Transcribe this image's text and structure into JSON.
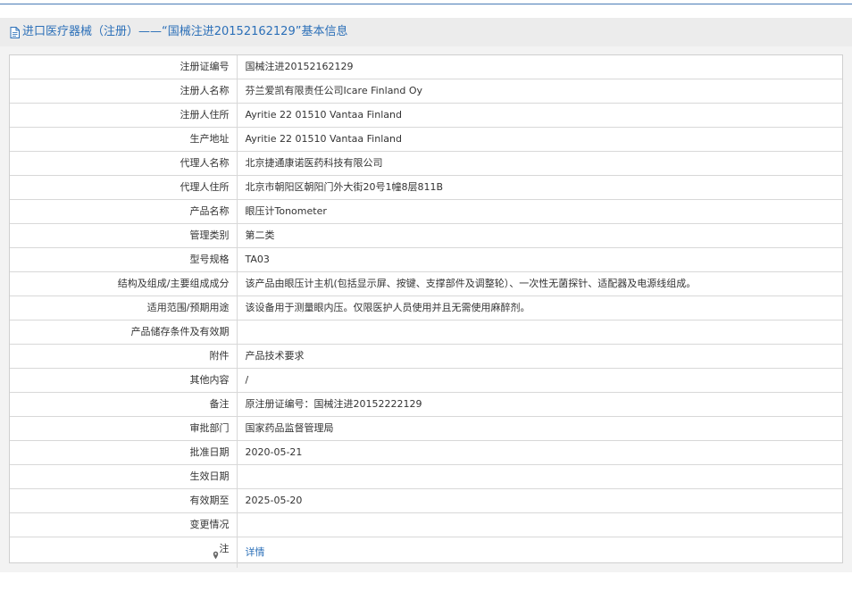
{
  "header": {
    "title": "进口医疗器械（注册）——“国械注进20152162129”基本信息"
  },
  "rows": [
    {
      "label": "注册证编号",
      "value": "国械注进20152162129"
    },
    {
      "label": "注册人名称",
      "value": "芬兰爱凯有限责任公司Icare Finland Oy"
    },
    {
      "label": "注册人住所",
      "value": "Ayritie 22 01510 Vantaa Finland"
    },
    {
      "label": "生产地址",
      "value": "Ayritie 22 01510 Vantaa Finland"
    },
    {
      "label": "代理人名称",
      "value": "北京捷通康诺医药科技有限公司"
    },
    {
      "label": "代理人住所",
      "value": "北京市朝阳区朝阳门外大街20号1幢8层811B"
    },
    {
      "label": "产品名称",
      "value": "眼压计Tonometer"
    },
    {
      "label": "管理类别",
      "value": "第二类"
    },
    {
      "label": "型号规格",
      "value": "TA03"
    },
    {
      "label": "结构及组成/主要组成成分",
      "value": "该产品由眼压计主机(包括显示屏、按键、支撑部件及调整轮）、一次性无菌探针、适配器及电源线组成。"
    },
    {
      "label": "适用范围/预期用途",
      "value": "该设备用于测量眼内压。仅限医护人员使用并且无需使用麻醉剂。"
    },
    {
      "label": "产品储存条件及有效期",
      "value": ""
    },
    {
      "label": "附件",
      "value": "产品技术要求"
    },
    {
      "label": "其他内容",
      "value": "/"
    },
    {
      "label": "备注",
      "value": "原注册证编号：国械注进20152222129"
    },
    {
      "label": "审批部门",
      "value": "国家药品监督管理局"
    },
    {
      "label": "批准日期",
      "value": "2020-05-21"
    },
    {
      "label": "生效日期",
      "value": ""
    },
    {
      "label": "有效期至",
      "value": "2025-05-20"
    },
    {
      "label": "变更情况",
      "value": ""
    }
  ],
  "note_row": {
    "label": "注",
    "link_text": "详情"
  }
}
